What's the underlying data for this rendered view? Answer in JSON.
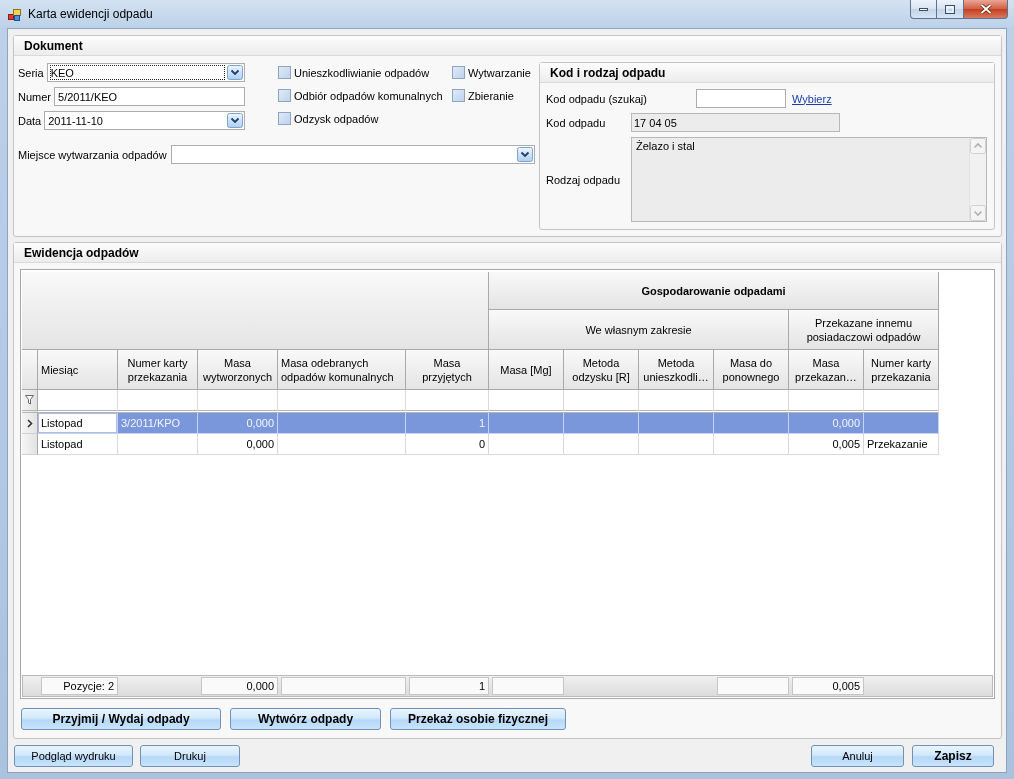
{
  "window": {
    "title": "Karta ewidencji odpadu"
  },
  "dokument": {
    "title": "Dokument",
    "fields": [
      {
        "label": "Seria",
        "value": "KEO",
        "kind": "combo",
        "focused": true
      },
      {
        "label": "Numer",
        "value": "5/2011/KEO",
        "kind": "text",
        "focused": false
      },
      {
        "label": "Data",
        "value": "2011-11-10",
        "kind": "combo",
        "focused": false
      }
    ],
    "checkbox_columns": [
      {
        "items": [
          {
            "label": "Unieszkodliwianie odpadów",
            "checked": false
          },
          {
            "label": "Odbiór odpadów komunalnych",
            "checked": false
          },
          {
            "label": "Odzysk odpadów",
            "checked": false
          }
        ]
      },
      {
        "items": [
          {
            "label": "Wytwarzanie",
            "checked": false
          },
          {
            "label": "Zbieranie",
            "checked": false
          }
        ]
      }
    ],
    "place": {
      "label": "Miejsce wytwarzania odpadów"
    }
  },
  "kod_panel": {
    "title": "Kod i rodzaj odpadu",
    "search": {
      "label": "Kod odpadu (szukaj)",
      "link": "Wybierz"
    },
    "code": {
      "label": "Kod odpadu",
      "value": "17 04 05"
    },
    "waste_type": {
      "label": "Rodzaj odpadu",
      "value": "Żelazo i stal"
    }
  },
  "ewidencja": {
    "title": "Ewidencja odpadów",
    "columns": [
      {
        "label": "Miesiąc",
        "kind": "text"
      },
      {
        "label": "Numer karty przekazania",
        "kind": "text"
      },
      {
        "label": "Masa wytworzonych",
        "kind": "number"
      },
      {
        "label": "Masa odebranych odpadów komunalnych",
        "kind": "number"
      },
      {
        "label": "Masa przyjętych",
        "kind": "number"
      }
    ],
    "group": {
      "label": "Gospodarowanie odpadami",
      "subgroups": [
        {
          "label": "We własnym zakresie",
          "columns": [
            {
              "label": "Masa [Mg]",
              "kind": "number"
            },
            {
              "label": "Metoda odzysku [R]",
              "kind": "text"
            },
            {
              "label": "Metoda unieszkodli…",
              "kind": "text"
            },
            {
              "label": "Masa do ponownego",
              "kind": "number"
            }
          ]
        },
        {
          "label": "Przekazane innemu posiadaczowi odpadów",
          "columns": [
            {
              "label": "Masa przekazan…",
              "kind": "number"
            },
            {
              "label": "Numer karty przekazania",
              "kind": "text"
            }
          ]
        }
      ]
    },
    "rows": [
      {
        "current": true,
        "selected": true,
        "cells": [
          {
            "text": "Listopad",
            "focused": true
          },
          {
            "text": "3/2011/KPO",
            "focused": false
          },
          {
            "text": "0,000",
            "focused": false
          },
          {
            "focused": false
          },
          {
            "text": "1",
            "focused": false
          },
          {
            "focused": false
          },
          {
            "focused": false
          },
          {
            "focused": false
          },
          {
            "focused": false
          },
          {
            "text": "0,000",
            "focused": false
          },
          {
            "focused": false
          }
        ]
      },
      {
        "current": false,
        "selected": false,
        "cells": [
          {
            "text": "Listopad",
            "focused": false
          },
          {
            "focused": false
          },
          {
            "text": "0,000",
            "focused": false
          },
          {
            "focused": false
          },
          {
            "text": "0",
            "focused": false
          },
          {
            "focused": false
          },
          {
            "focused": false
          },
          {
            "focused": false
          },
          {
            "focused": false
          },
          {
            "text": "0,005",
            "focused": false
          },
          {
            "text": "Przekazanie",
            "focused": false
          }
        ]
      }
    ],
    "summary": [
      {
        "kind": "box",
        "text": "Pozycje: 2"
      },
      {
        "kind": "none"
      },
      {
        "kind": "box",
        "text": "0,000"
      },
      {
        "kind": "box"
      },
      {
        "kind": "box",
        "text": "1"
      },
      {
        "kind": "box"
      },
      {
        "kind": "none"
      },
      {
        "kind": "none"
      },
      {
        "kind": "box"
      },
      {
        "kind": "box",
        "text": "0,005"
      },
      {
        "kind": "none"
      }
    ],
    "actions": [
      {
        "label": "Przyjmij / Wydaj odpady"
      },
      {
        "label": "Wytwórz odpady"
      },
      {
        "label": "Przekaż osobie fizycznej"
      }
    ]
  },
  "footer": {
    "left": [
      {
        "label": "Podgląd wydruku",
        "default": false
      },
      {
        "label": "Drukuj",
        "default": false
      }
    ],
    "right": [
      {
        "label": "Anuluj",
        "default": false
      },
      {
        "label": "Zapisz",
        "default": true
      }
    ]
  }
}
